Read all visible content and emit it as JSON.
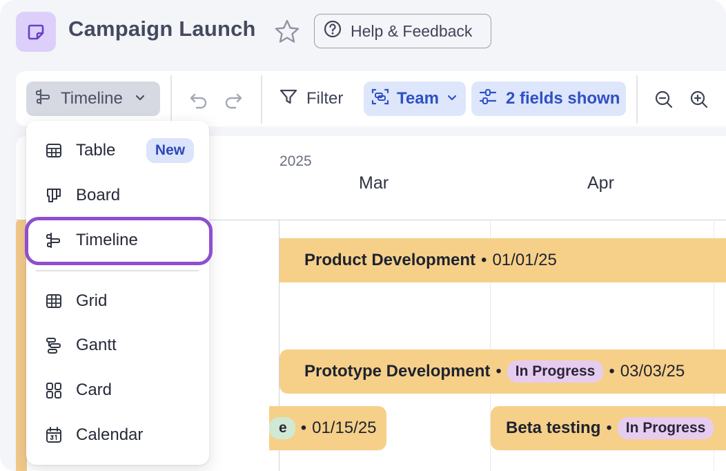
{
  "header": {
    "title": "Campaign Launch",
    "help_label": "Help & Feedback"
  },
  "toolbar": {
    "view_label": "Timeline",
    "filter_label": "Filter",
    "team_label": "Team",
    "fields_label": "2 fields shown"
  },
  "view_menu": {
    "items": [
      {
        "label": "Table",
        "icon": "table-icon",
        "badge": "New"
      },
      {
        "label": "Board",
        "icon": "board-icon"
      },
      {
        "label": "Timeline",
        "icon": "timeline-icon",
        "selected": true
      },
      {
        "label": "Grid",
        "icon": "grid-icon"
      },
      {
        "label": "Gantt",
        "icon": "gantt-icon"
      },
      {
        "label": "Card",
        "icon": "card-icon"
      },
      {
        "label": "Calendar",
        "icon": "calendar-icon"
      }
    ]
  },
  "timeline": {
    "year": "2025",
    "months": [
      "Mar",
      "Apr"
    ],
    "bars": [
      {
        "name": "Product Development",
        "date": "01/01/25"
      },
      {
        "name": "Prototype Development",
        "status": "In Progress",
        "date": "03/03/25"
      },
      {
        "status_partial": "e",
        "date": "01/15/25"
      },
      {
        "name": "Beta testing",
        "status": "In Progress"
      }
    ]
  },
  "colors": {
    "accent_purple": "#8e4fd0",
    "bar_fill": "#f6d088",
    "status_in_progress": "#e6cdf0",
    "chip_blue": "#dde6fb"
  }
}
